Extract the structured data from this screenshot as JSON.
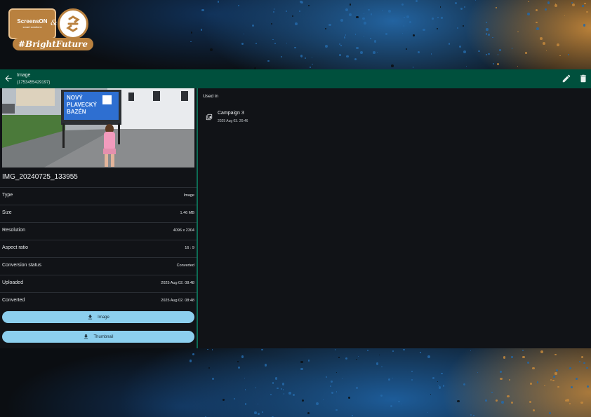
{
  "background": {
    "colors": {
      "orange": "#c4883c",
      "blue": "#2468a8",
      "dark": "#0b0e12"
    }
  },
  "logo": {
    "brand_main": "ScreensON",
    "brand_sub": "smart solutions",
    "ampersand": "&",
    "hashtag": "#BrightFuture"
  },
  "header": {
    "title": "Image",
    "subtitle": "(1753455429197)",
    "back_icon": "arrow-left-icon",
    "edit_icon": "pencil-icon",
    "delete_icon": "trash-icon",
    "accent": "#00503d"
  },
  "media": {
    "filename": "IMG_20240725_133955",
    "preview_sign_text": [
      "NOVÝ",
      "PLAVECKÝ",
      "BAZÉN"
    ]
  },
  "details": [
    {
      "label": "Type",
      "value": "Image"
    },
    {
      "label": "Size",
      "value": "1.46 MB"
    },
    {
      "label": "Resolution",
      "value": "4096 x 2304"
    },
    {
      "label": "Aspect ratio",
      "value": "16 : 9"
    },
    {
      "label": "Conversion status",
      "value": "Converted"
    },
    {
      "label": "Uploaded",
      "value": "2025 Aug 02. 08:48"
    },
    {
      "label": "Converted",
      "value": "2025 Aug 02. 08:48"
    }
  ],
  "buttons": {
    "image_label": "Image",
    "thumbnail_label": "Thumbnail",
    "icon": "download-icon",
    "color": "#8ccfee"
  },
  "used_in": {
    "title": "Used in",
    "items": [
      {
        "name": "Campaign 3",
        "date": "2025 Aug 03. 20:46",
        "icon": "campaign-icon"
      }
    ]
  }
}
